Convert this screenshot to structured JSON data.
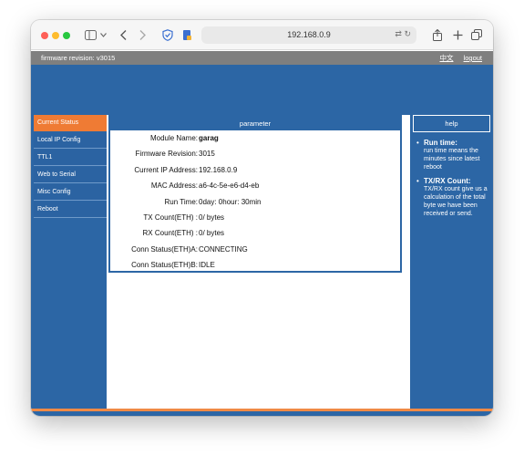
{
  "browser": {
    "url": "192.168.0.9"
  },
  "header": {
    "firmware_label": "firmware revision:",
    "firmware_version": "v3015",
    "language_link": "中文",
    "logout_link": "logout"
  },
  "sidebar": {
    "items": [
      {
        "label": "Current Status",
        "active": true
      },
      {
        "label": "Local IP Config",
        "active": false
      },
      {
        "label": "TTL1",
        "active": false
      },
      {
        "label": "Web to Serial",
        "active": false
      },
      {
        "label": "Misc Config",
        "active": false
      },
      {
        "label": "Reboot",
        "active": false
      }
    ]
  },
  "panel": {
    "title": "parameter",
    "rows": [
      {
        "label": "Module Name:",
        "value": "garag"
      },
      {
        "label": "Firmware Revision:",
        "value": "3015"
      },
      {
        "label": "Current IP Address:",
        "value": "192.168.0.9"
      },
      {
        "label": "MAC Address:",
        "value": "a6-4c-5e-e6-d4-eb"
      },
      {
        "label": "Run Time:",
        "value": "0day: 0hour: 30min"
      },
      {
        "label": "TX Count(ETH) :",
        "value": "0/ bytes"
      },
      {
        "label": "RX Count(ETH) :",
        "value": "0/ bytes"
      },
      {
        "label": "Conn Status(ETH)A:",
        "value": "CONNECTING"
      },
      {
        "label": "Conn Status(ETH)B:",
        "value": "IDLE"
      }
    ]
  },
  "help": {
    "title": "help",
    "items": [
      {
        "title": "Run time:",
        "text": "run time means the minutes since latest reboot"
      },
      {
        "title": "TX/RX Count:",
        "text": "TX/RX count give us a calculation of the total byte we have been received or send."
      }
    ]
  },
  "colors": {
    "accent_blue": "#2c66a5",
    "active_orange": "#ef7b34",
    "header_gray": "#7f7f7f"
  },
  "icons": [
    "sidebar-toggle-icon",
    "chevron-down-icon",
    "back-icon",
    "forward-icon",
    "shield-icon",
    "extension-icon",
    "translate-icon",
    "reload-icon",
    "share-icon",
    "new-tab-icon",
    "tabs-overview-icon"
  ]
}
